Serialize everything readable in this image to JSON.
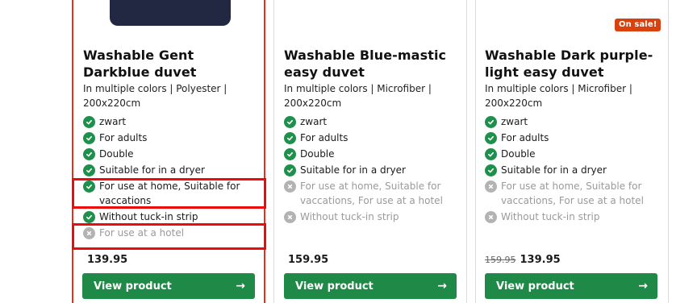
{
  "products": [
    {
      "title": "Washable Gent Darkblue duvet",
      "subtitle": "In multiple colors | Polyester | 200x220cm",
      "features": [
        {
          "label": "zwart",
          "available": true
        },
        {
          "label": "For adults",
          "available": true
        },
        {
          "label": "Double",
          "available": true
        },
        {
          "label": "Suitable for in a dryer",
          "available": true
        },
        {
          "label": "For use at home, Suitable for vaccations",
          "available": true
        },
        {
          "label": "Without tuck-in strip",
          "available": true
        },
        {
          "label": "For use at a hotel",
          "available": false
        }
      ],
      "old_price": "",
      "price": "139.95",
      "button_label": "View product",
      "button_arrow": "→"
    },
    {
      "title": "Washable Blue-mastic easy duvet",
      "subtitle": "In multiple colors | Microfiber | 200x220cm",
      "features": [
        {
          "label": "zwart",
          "available": true
        },
        {
          "label": "For adults",
          "available": true
        },
        {
          "label": "Double",
          "available": true
        },
        {
          "label": "Suitable for in a dryer",
          "available": true
        },
        {
          "label": "For use at home, Suitable for vaccations, For use at a hotel",
          "available": false
        },
        {
          "label": "Without tuck-in strip",
          "available": false
        }
      ],
      "old_price": "",
      "price": "159.95",
      "button_label": "View product",
      "button_arrow": "→"
    },
    {
      "title": "Washable Dark purple-light easy duvet",
      "subtitle": "In multiple colors | Microfiber | 200x220cm",
      "badge": "On sale!",
      "features": [
        {
          "label": "zwart",
          "available": true
        },
        {
          "label": "For adults",
          "available": true
        },
        {
          "label": "Double",
          "available": true
        },
        {
          "label": "Suitable for in a dryer",
          "available": true
        },
        {
          "label": "For use at home, Suitable for vaccations, For use at a hotel",
          "available": false
        },
        {
          "label": "Without tuck-in strip",
          "available": false
        }
      ],
      "old_price": "159.95",
      "price": "139.95",
      "button_label": "View product",
      "button_arrow": "→"
    }
  ],
  "icons": {
    "available": "check-circle-icon",
    "unavailable": "x-circle-icon"
  },
  "colors": {
    "button_green": "#1f8a47",
    "check_green": "#1f8f4c",
    "unavailable_gray": "#b3b3b3",
    "sale_badge": "#d7420f",
    "highlight_red": "#ec0c0c"
  }
}
